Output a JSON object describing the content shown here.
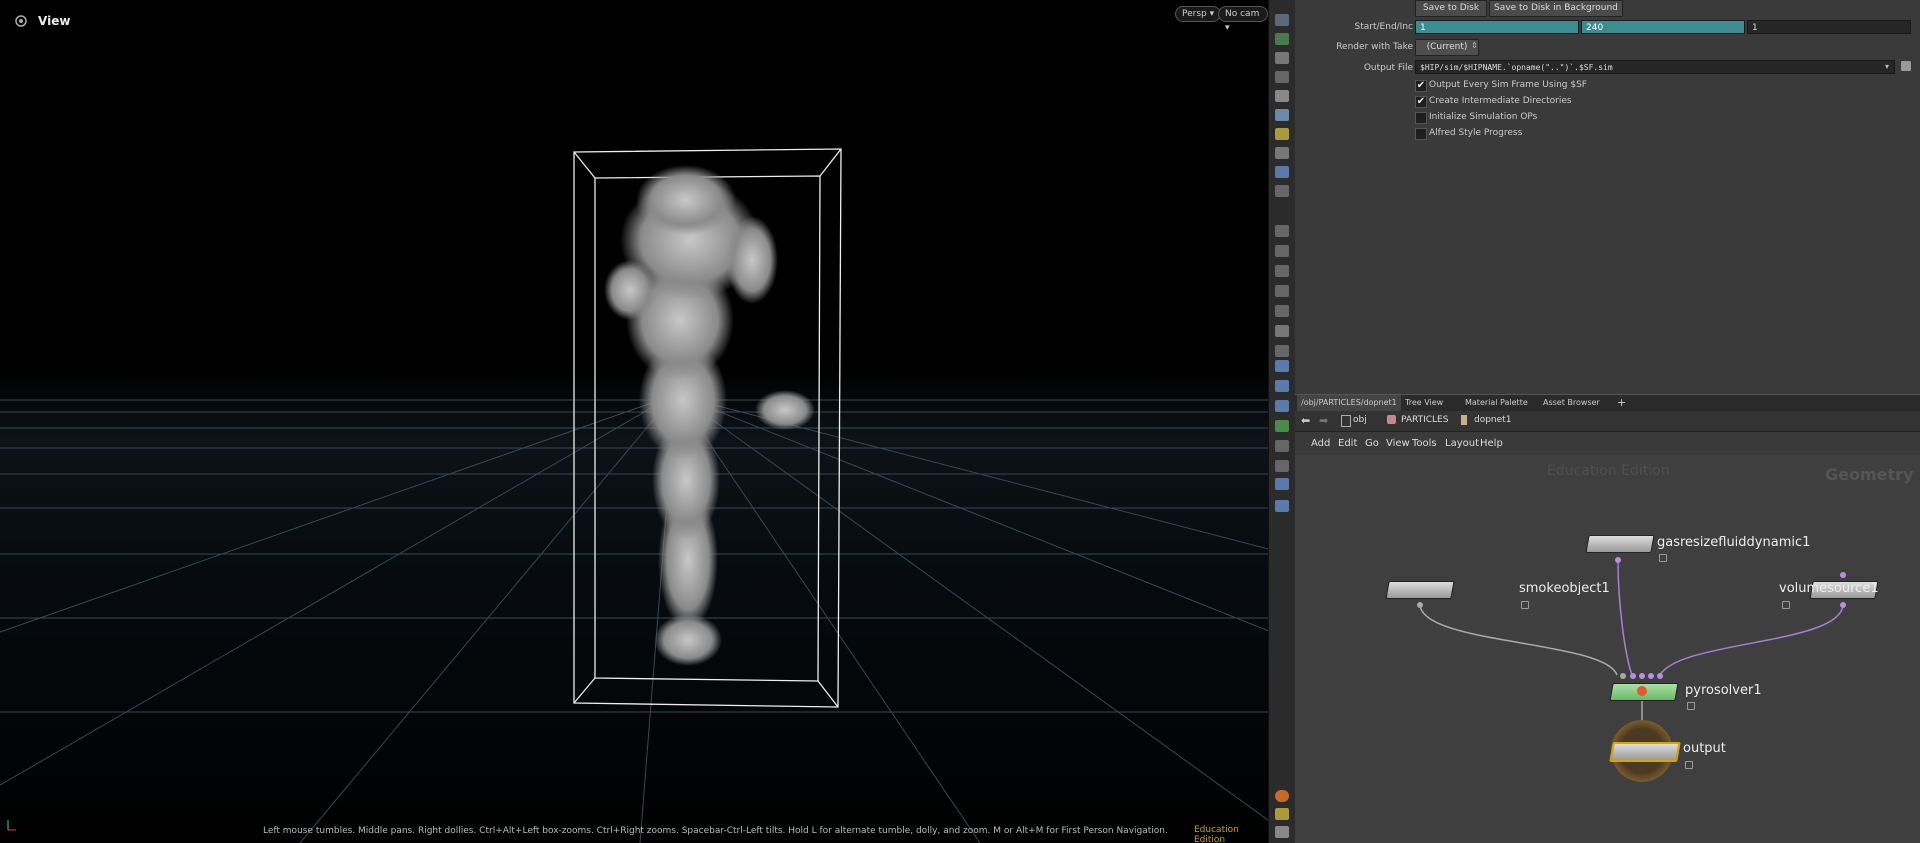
{
  "viewport": {
    "title": "View",
    "persp_button": "Persp ▾",
    "cam_button": "No cam ▾",
    "status": "Left mouse tumbles. Middle pans. Right dollies. Ctrl+Alt+Left box-zooms. Ctrl+Right zooms. Spacebar-Ctrl-Left tilts. Hold L for alternate tumble, dolly, and zoom. M or Alt+M for First Person Navigation.",
    "edition": "Education Edition"
  },
  "params": {
    "save_button": "Save to Disk",
    "save_bg_button": "Save to Disk in Background",
    "start_end_inc_label": "Start/End/Inc",
    "start": "1",
    "end": "240",
    "inc": "1",
    "render_take_label": "Render with Take",
    "render_take_value": "(Current)",
    "output_file_label": "Output File",
    "output_file_value": "$HIP/sim/$HIPNAME.`opname(\"..\")`.$SF.sim",
    "checkboxes": [
      {
        "label": "Output Every Sim Frame Using $SF",
        "checked": "✔"
      },
      {
        "label": "Create Intermediate Directories",
        "checked": "✔"
      },
      {
        "label": "Initialize Simulation OPs",
        "checked": ""
      },
      {
        "label": "Alfred Style Progress",
        "checked": ""
      }
    ]
  },
  "tabs": [
    "/obj/PARTICLES/dopnet1",
    "Tree View",
    "Material Palette",
    "Asset Browser",
    "+"
  ],
  "path": {
    "obj": "obj",
    "particles": "PARTICLES",
    "dopnet": "dopnet1"
  },
  "menu": [
    "Add",
    "Edit",
    "Go",
    "View",
    "Tools",
    "Layout",
    "Help"
  ],
  "network": {
    "edition": "Education Edition",
    "context": "Geometry",
    "nodes": {
      "gasresize": "gasresizefluiddynamic1",
      "smoke": "smokeobject1",
      "volumesource": "volumesource1",
      "pyrosolver": "pyrosolver1",
      "output": "output"
    }
  },
  "colors": {
    "accent": "#3c8d8f",
    "solver": "#7ec97a",
    "output_ring": "#d9a400"
  }
}
